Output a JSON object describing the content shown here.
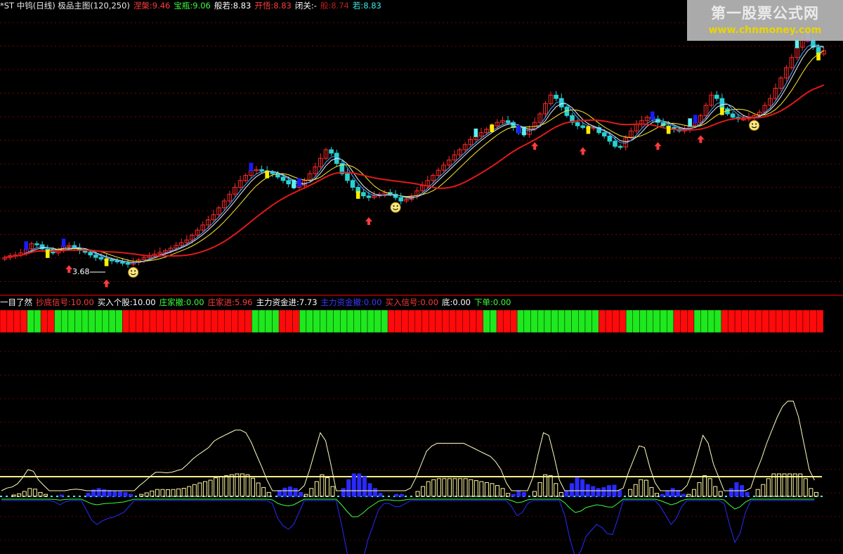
{
  "colors": {
    "background": "#000000",
    "bull": "#ff2b2b",
    "bear": "#28d2d2",
    "ma_long": "#e01919",
    "signal_up": "#ff3b3b",
    "block_red": "#ff0a0a",
    "block_green": "#1ee81e",
    "separator": "#b00000"
  },
  "main_legend": [
    {
      "label": "*ST 中钨(日线) 极品主图(120,250)",
      "color": "#e8e8e8"
    },
    {
      "label": "涅槃:9.46",
      "color": "#ff3b3b"
    },
    {
      "label": "宝瓶:9.06",
      "color": "#3cff3c"
    },
    {
      "label": "般若:8.83",
      "color": "#ffffff"
    },
    {
      "label": "开悟:8.83",
      "color": "#ff3b3b"
    },
    {
      "label": "闭关:-",
      "color": "#ffffff"
    },
    {
      "label": "般:8.74",
      "color": "#b82020"
    },
    {
      "label": "若:8.83",
      "color": "#3ce8e8"
    }
  ],
  "mid_legend": [
    {
      "label": "一目了然",
      "color": "#ffffff"
    },
    {
      "label": "抄底信号:10.00",
      "color": "#ff3b3b"
    },
    {
      "label": "买入个股:10.00",
      "color": "#ffffff"
    },
    {
      "label": "庄家撤:0.00",
      "color": "#3cff3c"
    },
    {
      "label": "庄家进:5.96",
      "color": "#ff3b3b"
    },
    {
      "label": "主力资金进:7.73",
      "color": "#ffffff"
    },
    {
      "label": "主力资金撤:0.00",
      "color": "#3a3aff"
    },
    {
      "label": "买入信号:0.00",
      "color": "#ff3b3b"
    },
    {
      "label": "底:0.00",
      "color": "#ffffff"
    },
    {
      "label": "下单:0.00",
      "color": "#3cff3c"
    }
  ],
  "watermark": {
    "line1": "第一股票公式网",
    "line2": "www.chnmoney.com"
  },
  "low_price_label": "3.68",
  "block_signals": "RRRRGGRRGGGGGGGGGGRRRRRRRRRRRRRRRRRRRGGGGRRRGGGGGGGGGGGGGRRRRRRRRRRRRRRGGRRRGGGGGGGGGGGGRRRRGGGGGGGRRRGGGGRRRRRRRRRRRRRRR",
  "closes": [
    4.05,
    4.1,
    4.12,
    4.18,
    4.3,
    4.45,
    4.42,
    4.3,
    4.22,
    4.18,
    4.28,
    4.38,
    4.4,
    4.32,
    4.25,
    4.2,
    4.12,
    4.05,
    4.0,
    3.98,
    3.95,
    3.92,
    3.88,
    3.85,
    3.9,
    3.98,
    4.05,
    4.1,
    4.15,
    4.2,
    4.25,
    4.32,
    4.4,
    4.48,
    4.56,
    4.7,
    4.85,
    5.0,
    5.15,
    5.3,
    5.5,
    5.7,
    5.9,
    6.1,
    6.3,
    6.45,
    6.6,
    6.62,
    6.58,
    6.55,
    6.5,
    6.4,
    6.3,
    6.2,
    6.1,
    6.15,
    6.3,
    6.5,
    6.7,
    6.95,
    7.2,
    7.1,
    6.8,
    6.5,
    6.3,
    6.1,
    5.95,
    5.85,
    5.8,
    5.85,
    5.9,
    5.95,
    5.9,
    5.8,
    5.7,
    5.75,
    5.85,
    6.0,
    6.15,
    6.3,
    6.45,
    6.6,
    6.75,
    6.9,
    7.05,
    7.2,
    7.35,
    7.5,
    7.6,
    7.7,
    7.8,
    7.9,
    8.0,
    8.05,
    8.0,
    7.85,
    7.7,
    7.65,
    7.8,
    8.0,
    8.25,
    8.55,
    8.8,
    8.7,
    8.45,
    8.2,
    8.0,
    7.9,
    7.85,
    7.85,
    7.85,
    7.7,
    7.6,
    7.45,
    7.3,
    7.28,
    7.55,
    7.75,
    7.95,
    8.05,
    8.15,
    8.1,
    8.0,
    7.9,
    7.85,
    7.8,
    7.75,
    7.8,
    7.9,
    8.0,
    8.2,
    8.5,
    8.8,
    8.7,
    8.4,
    8.25,
    8.15,
    8.1,
    8.1,
    8.15,
    8.2,
    8.3,
    8.5,
    8.7,
    9.0,
    9.3,
    9.6,
    9.9,
    10.2,
    10.4,
    10.4,
    10.2,
    10.0,
    10.1
  ]
}
